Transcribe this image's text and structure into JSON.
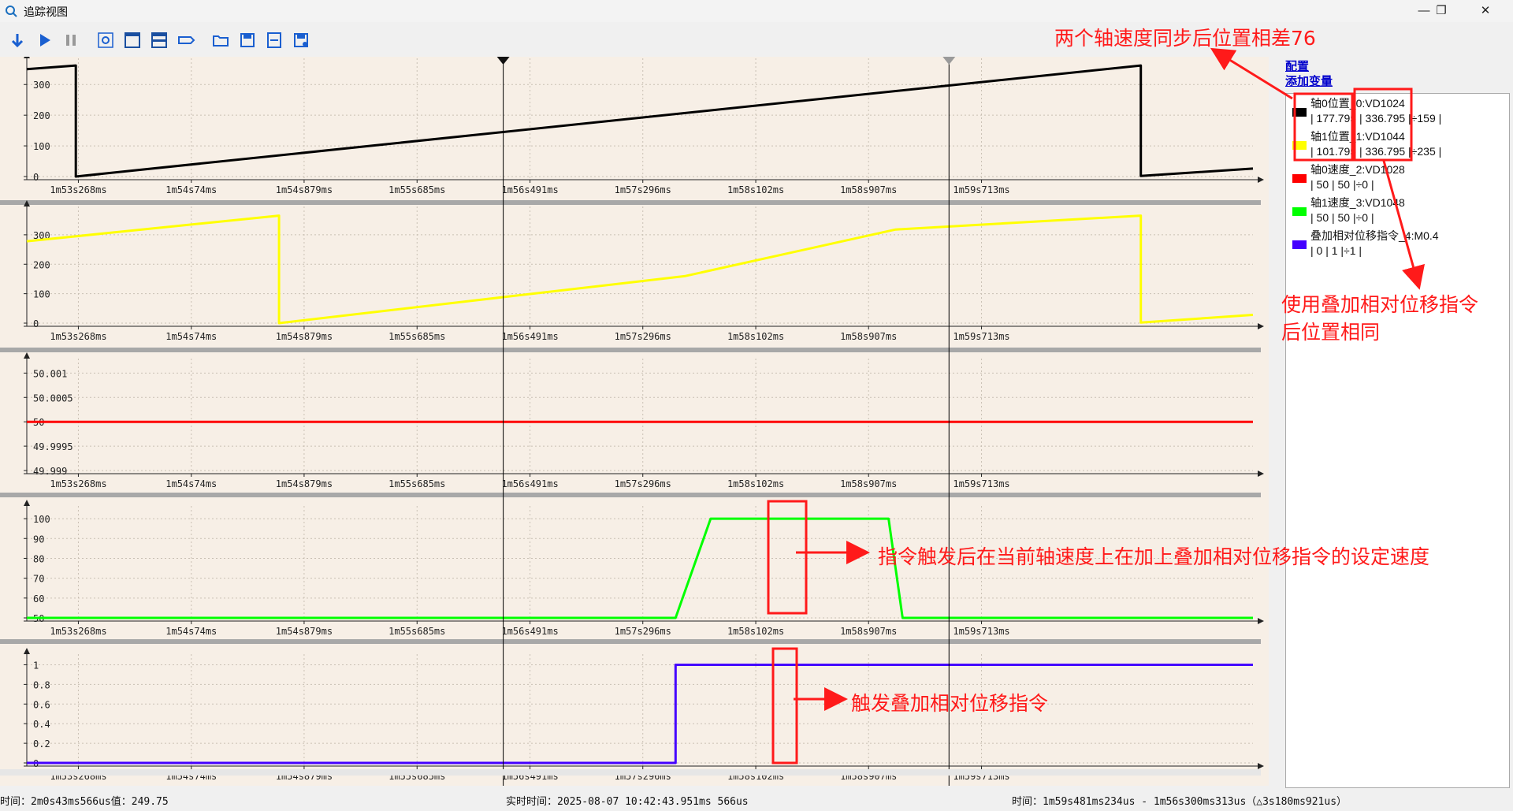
{
  "window": {
    "title": "追踪视图",
    "minimize_label": "—",
    "restore_label": "❐",
    "close_label": "✕"
  },
  "toolbar": {
    "buttons": [
      {
        "name": "download-button",
        "icon": "arrow-down-icon"
      },
      {
        "name": "play-button",
        "icon": "play-icon"
      },
      {
        "name": "pause-button",
        "icon": "pause-icon"
      },
      {
        "name": "settings-button",
        "icon": "settings-icon"
      },
      {
        "name": "single-view-button",
        "icon": "window-icon"
      },
      {
        "name": "split-view-button",
        "icon": "split-window-icon"
      },
      {
        "name": "tag-button",
        "icon": "tag-icon"
      },
      {
        "name": "open-button",
        "icon": "folder-open-icon"
      },
      {
        "name": "save-button",
        "icon": "save-icon"
      },
      {
        "name": "export-csv-button",
        "icon": "csv-icon"
      },
      {
        "name": "save-as-button",
        "icon": "save-as-icon"
      }
    ]
  },
  "sidebar": {
    "config_link": "配置",
    "add_variable_link": "添加变量"
  },
  "legend": [
    {
      "name": "轴0位置_0:VD1024",
      "values": "| 177.795 | 336.795 |÷159 |",
      "color": "#000000"
    },
    {
      "name": "轴1位置_1:VD1044",
      "values": "| 101.795 | 336.795 |÷235 |",
      "color": "#ffff00"
    },
    {
      "name": "轴0速度_2:VD1028",
      "values": "| 50 | 50 |÷0 |",
      "color": "#ff0000"
    },
    {
      "name": "轴1速度_3:VD1048",
      "values": "| 50 | 50 |÷0 |",
      "color": "#00ff00"
    },
    {
      "name": "叠加相对位移指令_4:M0.4",
      "values": "| 0 | 1 |÷1 |",
      "color": "#4400ff"
    }
  ],
  "annotations": {
    "top": "两个轴速度同步后位置相差76",
    "right_line1": "使用叠加相对位移指令",
    "right_line2": "后位置相同",
    "speed": "指令触发后在当前轴速度上在加上叠加相对位移指令的设定速度",
    "trigger": "触发叠加相对位移指令"
  },
  "status": {
    "left": "时间：2m0s43ms566us值：249.75",
    "center": "实时时间：2025-08-07 10:42:43.951ms 566us",
    "right": "时间：1m59s481ms234us - 1m56s300ms313us（△3s180ms921us）"
  },
  "chart_data": [
    {
      "type": "line",
      "series": [
        {
          "name": "轴0位置_0:VD1024",
          "color": "#000000",
          "values": [
            [
              52.9,
              350
            ],
            [
              53.25,
              362
            ],
            [
              53.25,
              0
            ],
            [
              60.85,
              362
            ],
            [
              60.85,
              2
            ],
            [
              61.65,
              26
            ]
          ]
        }
      ],
      "ylim": [
        0,
        370
      ],
      "yticks": [
        "0",
        "100",
        "200",
        "300"
      ],
      "ytick_values": [
        0,
        100,
        200,
        300
      ]
    },
    {
      "type": "line",
      "series": [
        {
          "name": "轴1位置_1:VD1044",
          "color": "#ffff00",
          "values": [
            [
              52.9,
              278
            ],
            [
              54.7,
              365
            ],
            [
              54.7,
              0
            ],
            [
              57.6,
              160
            ],
            [
              59.1,
              318
            ],
            [
              60.85,
              365
            ],
            [
              60.85,
              2
            ],
            [
              61.65,
              28
            ]
          ]
        }
      ],
      "ylim": [
        0,
        380
      ],
      "yticks": [
        "0",
        "100",
        "200",
        "300"
      ],
      "ytick_values": [
        0,
        100,
        200,
        300
      ]
    },
    {
      "type": "line",
      "series": [
        {
          "name": "轴0速度_2:VD1028",
          "color": "#ff0000",
          "values": [
            [
              52.9,
              50
            ],
            [
              61.65,
              50
            ]
          ]
        }
      ],
      "ylim": [
        49.999,
        50.0012
      ],
      "yticks": [
        "49.999",
        "49.9995",
        "50",
        "50.0005",
        "50.001"
      ],
      "ytick_values": [
        49.999,
        49.9995,
        50,
        50.0005,
        50.001
      ]
    },
    {
      "type": "line",
      "series": [
        {
          "name": "轴1速度_3:VD1048",
          "color": "#00ff00",
          "values": [
            [
              52.9,
              50
            ],
            [
              57.53,
              50
            ],
            [
              57.78,
              100
            ],
            [
              59.05,
              100
            ],
            [
              59.15,
              50
            ],
            [
              61.65,
              50
            ]
          ]
        }
      ],
      "ylim": [
        50,
        104
      ],
      "yticks": [
        "50",
        "60",
        "70",
        "80",
        "90",
        "100"
      ],
      "ytick_values": [
        50,
        60,
        70,
        80,
        90,
        100
      ]
    },
    {
      "type": "line",
      "series": [
        {
          "name": "叠加相对位移指令_4:M0.4",
          "color": "#4400ff",
          "values": [
            [
              52.9,
              0
            ],
            [
              57.53,
              0
            ],
            [
              57.53,
              1
            ],
            [
              61.65,
              1
            ]
          ]
        }
      ],
      "ylim": [
        0,
        1.06
      ],
      "yticks": [
        "0",
        "0.2",
        "0.4",
        "0.6",
        "0.8",
        "1"
      ],
      "ytick_values": [
        0,
        0.2,
        0.4,
        0.6,
        0.8,
        1
      ]
    }
  ],
  "x_axis": {
    "unit": "seconds (after 1m)",
    "xlim": [
      52.9,
      61.65
    ],
    "tick_labels": [
      "1m53s268ms",
      "1m54s74ms",
      "1m54s879ms",
      "1m55s685ms",
      "1m56s491ms",
      "1m57s296ms",
      "1m58s102ms",
      "1m58s907ms",
      "1m59s713ms"
    ],
    "tick_values": [
      53.268,
      54.074,
      54.879,
      55.685,
      56.491,
      57.296,
      58.102,
      58.907,
      59.713
    ],
    "cursors": [
      56.3,
      59.481
    ]
  }
}
